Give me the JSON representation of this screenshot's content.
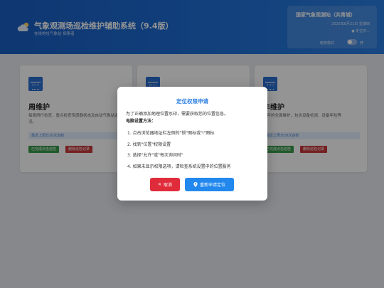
{
  "header": {
    "title": "气象观测场巡检维护辅助系统（9.4版）",
    "subtitle": "在线地址气象站 探索者",
    "icon": "cloud-sun-icon",
    "station": {
      "name": "国家气象观测站（共青城）",
      "date": "2025年8月21日 星期四",
      "location": "● 定位中...",
      "mode_label": "暗夜模式",
      "toggle_state": "开"
    }
  },
  "cards": [
    {
      "title": "周维护",
      "description": "每周例行检查，重点检查传感器状态及自动气象站运行情况。",
      "last": "最近上周日20次巡检",
      "complete_label": "已完成点击巡检",
      "record_label": "删除巡检记录"
    },
    {
      "title": "",
      "description": "",
      "last": "",
      "complete_label": "",
      "record_label": ""
    },
    {
      "title": "年维护",
      "description": "全年的全面维护，包含设备检测、设备年检等",
      "last": "最近上周日20次巡检",
      "complete_label": "已完成点击巡检",
      "record_label": "删除巡检记录"
    }
  ],
  "modal": {
    "title": "定位权限申请",
    "intro": "为了正确添加地理位置水印，需要获取您的位置信息。",
    "method_label": "电脑设置方法：",
    "steps": [
      "1. 点击浏览器地址栏左侧的\"锁\"图标或\"i\"图标",
      "2. 找到\"位置\"权限设置",
      "3. 选择\"允许\"或\"每次询问时\"",
      "4. 如果未显示权限选项，请检查系统设置中的位置服务"
    ],
    "cancel_label": "取消",
    "retry_label": "重新申请定位"
  },
  "colors": {
    "header_bg": "#1f6fd6",
    "modal_title": "#2a7de0",
    "cancel": "#e02c3a",
    "retry": "#2288ee"
  }
}
